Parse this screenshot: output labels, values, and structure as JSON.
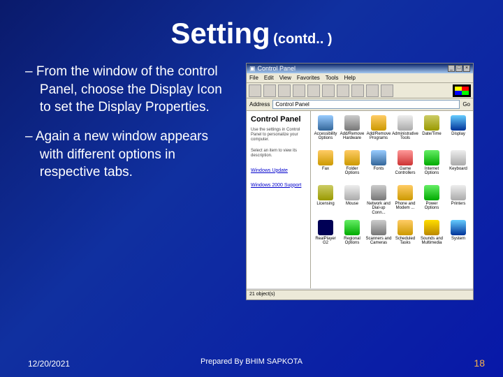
{
  "title": {
    "main": "Setting",
    "sub": "(contd.. )"
  },
  "bullets": [
    "From the window of the control Panel, choose the Display Icon to set the Display Properties.",
    "Again a new window appears with different options in respective tabs."
  ],
  "cp": {
    "winTitle": "Control Panel",
    "menus": [
      "File",
      "Edit",
      "View",
      "Favorites",
      "Tools",
      "Help"
    ],
    "addressLabel": "Address",
    "addressValue": "Control Panel",
    "go": "Go",
    "sideHeading": "Control Panel",
    "sideCaption1": "Use the settings in Control Panel to personalize your computer.",
    "sideCaption2": "Select an item to view its description.",
    "sideLink1": "Windows Update",
    "sideLink2": "Windows 2000 Support",
    "status1": "21 object(s)",
    "status2": " ",
    "icons": [
      {
        "label": "Accessibility Options",
        "c": "c3"
      },
      {
        "label": "Add/Remove Hardware",
        "c": "c6"
      },
      {
        "label": "Add/Remove Programs",
        "c": "c2"
      },
      {
        "label": "Administrative Tools",
        "c": "c11"
      },
      {
        "label": "Date/Time",
        "c": "c5"
      },
      {
        "label": "Display",
        "c": "c7"
      },
      {
        "label": "Fax",
        "c": "c2"
      },
      {
        "label": "Folder Options",
        "c": "c2"
      },
      {
        "label": "Fonts",
        "c": "c3"
      },
      {
        "label": "Game Controllers",
        "c": "c4"
      },
      {
        "label": "Internet Options",
        "c": "c9"
      },
      {
        "label": "Keyboard",
        "c": "c11"
      },
      {
        "label": "Licensing",
        "c": "c5"
      },
      {
        "label": "Mouse",
        "c": "c11"
      },
      {
        "label": "Network and Dial-up Conn...",
        "c": "c6"
      },
      {
        "label": "Phone and Modem ...",
        "c": "c2"
      },
      {
        "label": "Power Options",
        "c": "c9"
      },
      {
        "label": "Printers",
        "c": "c11"
      },
      {
        "label": "RealPlayer G2",
        "c": "c8"
      },
      {
        "label": "Regional Options",
        "c": "c9"
      },
      {
        "label": "Scanners and Cameras",
        "c": "c6"
      },
      {
        "label": "Scheduled Tasks",
        "c": "c2"
      },
      {
        "label": "Sounds and Multimedia",
        "c": "c10"
      },
      {
        "label": "System",
        "c": "c7"
      }
    ]
  },
  "footer": {
    "date": "12/20/2021",
    "author": "Prepared By BHIM SAPKOTA",
    "page": "18"
  }
}
